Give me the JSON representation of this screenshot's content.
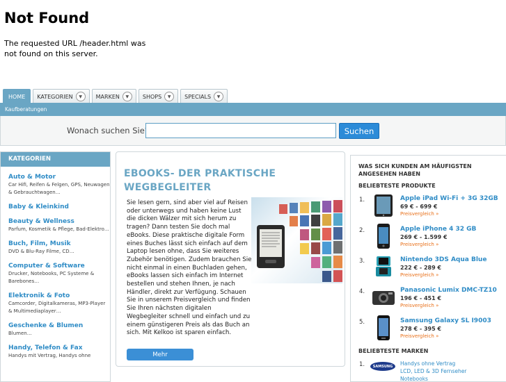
{
  "error": {
    "title": "Not Found",
    "message": "The requested URL /header.html was not found on this server."
  },
  "nav": {
    "tabs": [
      {
        "label": "HOME",
        "dropdown": false,
        "active": true
      },
      {
        "label": "KATEGORIEN",
        "dropdown": true
      },
      {
        "label": "MARKEN",
        "dropdown": true
      },
      {
        "label": "SHOPS",
        "dropdown": true
      },
      {
        "label": "SPECIALS",
        "dropdown": true
      }
    ],
    "subbar_link": "Kaufberatungen"
  },
  "search": {
    "label": "Wonach suchen Sie?",
    "placeholder": "",
    "value": "",
    "button": "Suchen"
  },
  "categories": {
    "heading": "KATEGORIEN",
    "items": [
      {
        "title": "Auto & Motor",
        "sub": "Car Hifi, Reifen & Felgen, GPS, Neuwagen & Gebrauchtwagen…"
      },
      {
        "title": "Baby & Kleinkind",
        "sub": ""
      },
      {
        "title": "Beauty & Wellness",
        "sub": "Parfum, Kosmetik & Pflege, Bad-Elektro…"
      },
      {
        "title": "Buch, Film, Musik",
        "sub": "DVD & Blu-Ray Filme, CD…"
      },
      {
        "title": "Computer & Software",
        "sub": "Drucker, Notebooks, PC Systeme & Barebones…"
      },
      {
        "title": "Elektronik & Foto",
        "sub": "Camcorder, Digitalkameras, MP3-Player & Multimediaplayer…"
      },
      {
        "title": "Geschenke & Blumen",
        "sub": "Blumen…"
      },
      {
        "title": "Handy, Telefon & Fax",
        "sub": "Handys mit Vertrag, Handys ohne"
      }
    ]
  },
  "feature": {
    "title": "EBOOKS- DER PRAKTISCHE WEGBEGLEITER",
    "body": "Sie lesen gern, sind aber viel auf Reisen oder unterwegs und haben keine Lust die dicken Wälzer mit sich herum zu tragen? Dann testen Sie doch mal eBooks. Diese praktische digitale Form eines Buches lässt sich einfach auf dem Laptop lesen ohne, dass Sie weiteres Zubehör benötigen. Zudem brauchen Sie nicht einmal in einen Buchladen gehen, eBooks lassen sich einfach im Internet bestellen und stehen Ihnen, je nach Händler, direkt zur Verfügung. Schauen Sie in unserem Preisvergleich und finden Sie Ihren nächsten digitalen Wegbegleiter schnell und einfach und zu einem günstigeren Preis als das Buch an sich. Mit Kelkoo ist sparen einfach.",
    "button": "Mehr"
  },
  "popular": {
    "heading": "WAS SICH KUNDEN AM HÄUFIGSTEN ANGESEHEN HABEN",
    "products_heading": "BELIEBTESTE PRODUKTE",
    "products": [
      {
        "num": "1.",
        "name": "Apple iPad Wi-Fi + 3G 32GB",
        "price": "69 € - 699 €",
        "link": "Preisvergleich »",
        "icon": "tablet-icon"
      },
      {
        "num": "2.",
        "name": "Apple iPhone 4 32 GB",
        "price": "269 € - 1.599 €",
        "link": "Preisvergleich »",
        "icon": "smartphone-icon"
      },
      {
        "num": "3.",
        "name": "Nintendo 3DS Aqua Blue",
        "price": "222 € - 289 €",
        "link": "Preisvergleich »",
        "icon": "handheld-console-icon"
      },
      {
        "num": "4.",
        "name": "Panasonic Lumix DMC-TZ10",
        "price": "196 € - 451 €",
        "link": "Preisvergleich »",
        "icon": "camera-icon"
      },
      {
        "num": "5.",
        "name": "Samsung Galaxy SL I9003",
        "price": "278 € - 395 €",
        "link": "Preisvergleich »",
        "icon": "smartphone-icon"
      }
    ],
    "brands_heading": "BELIEBTESTE MARKEN",
    "brands": [
      {
        "num": "1.",
        "logo_text": "SAMSUNG",
        "text": "Handys ohne Vertrag\nLCD, LED & 3D Fernseher\nNotebooks"
      }
    ]
  }
}
